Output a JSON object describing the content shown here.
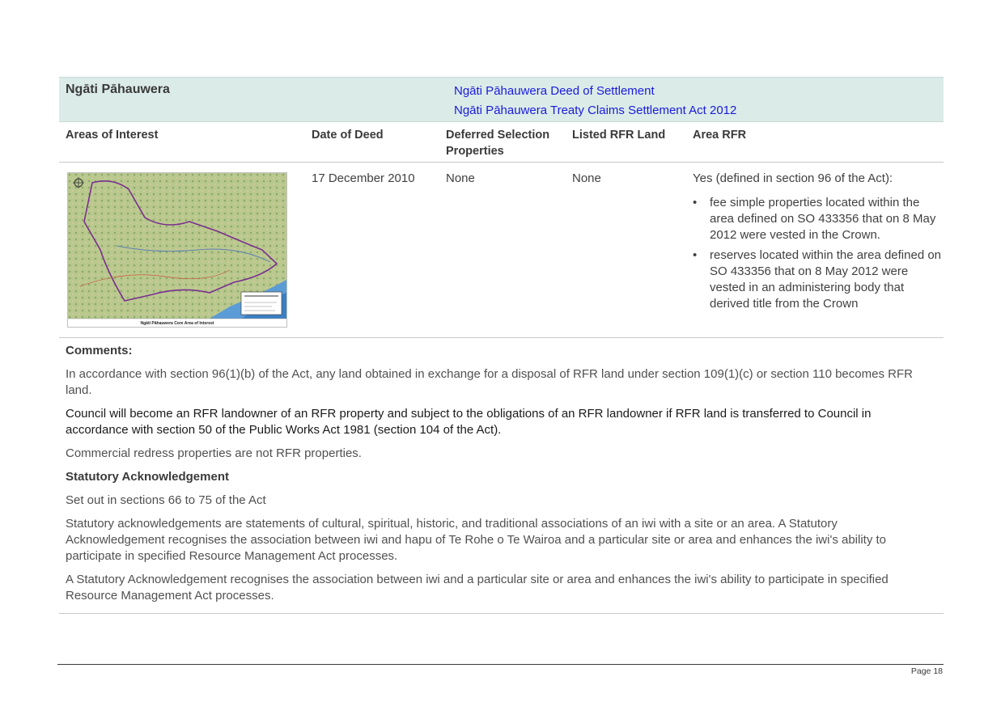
{
  "header": {
    "iwi_name": "Ngāti Pāhauwera",
    "links": [
      "Ngāti Pāhauwera Deed of Settlement",
      "Ngāti Pāhauwera Treaty Claims Settlement Act 2012"
    ]
  },
  "columns": {
    "areas": "Areas of Interest",
    "date": "Date of Deed",
    "deferred_line1": "Deferred Selection",
    "deferred_line2": "Properties",
    "listed": "Listed RFR Land",
    "area_rfr": "Area RFR"
  },
  "row": {
    "date": "17 December 2010",
    "deferred": "None",
    "listed": "None",
    "area_rfr_intro": "Yes (defined in section 96 of the Act):",
    "area_rfr_items": [
      "fee simple properties located within the area defined on SO 433356 that on 8 May 2012 were vested in the Crown.",
      "reserves located within the area defined on SO 433356 that on 8 May 2012 were vested in an administering body that derived title from the Crown"
    ],
    "map_caption": "Ngāti Pāhauwera Core Area of Interest"
  },
  "comments": {
    "heading": "Comments:",
    "p1": "In accordance with section 96(1)(b) of the Act, any land obtained in exchange for a disposal of RFR land under section 109(1)(c) or section 110 becomes RFR land.",
    "p2": "Council will become an RFR landowner of an RFR property and subject to the obligations of an RFR landowner if RFR land is transferred to Council in accordance with section 50 of the Public Works Act 1981 (section 104 of the Act).",
    "p3": "Commercial redress properties are not RFR properties.",
    "sa_heading": "Statutory Acknowledgement",
    "p4": "Set out in sections 66 to 75 of the Act",
    "p5": "Statutory acknowledgements are statements of cultural, spiritual, historic, and traditional associations of an iwi with a site or an area. A Statutory Acknowledgement recognises the association between iwi and hapu of Te Rohe o Te Wairoa and a particular site or area and enhances the iwi's ability to participate in specified Resource Management Act processes.",
    "p6": "A Statutory Acknowledgement recognises the association between iwi and a particular site or area and enhances the iwi's ability to participate in specified Resource Management Act processes."
  },
  "footer": {
    "page": "Page 18"
  }
}
